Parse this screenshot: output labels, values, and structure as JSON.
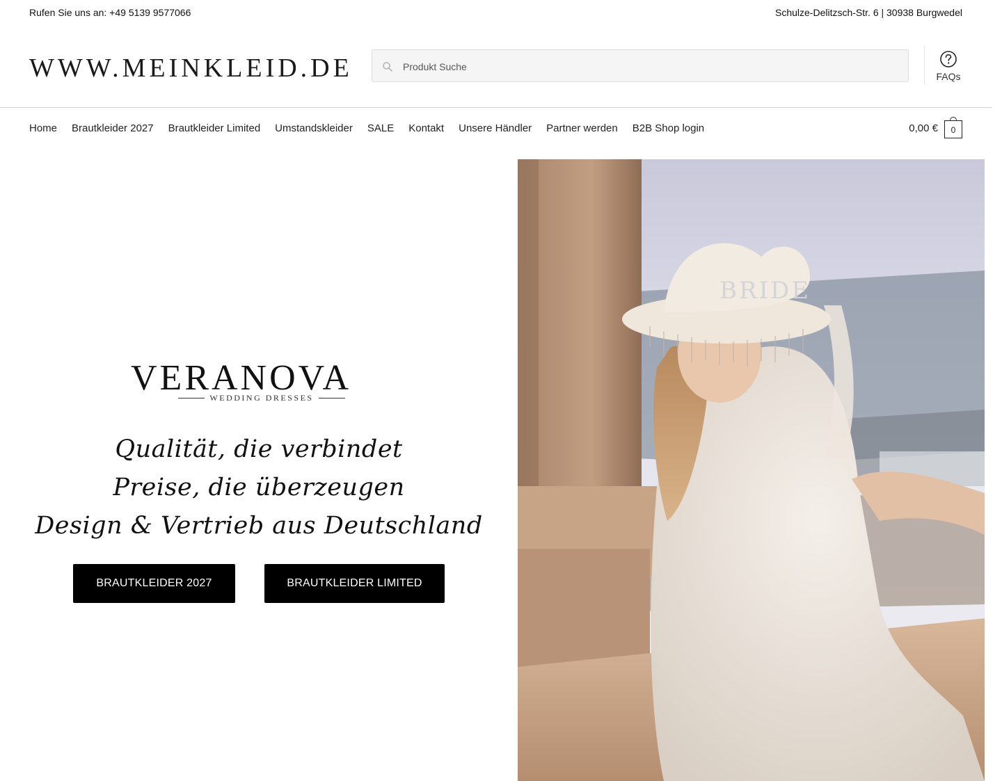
{
  "topbar": {
    "phone_text": "Rufen Sie uns an: +49 5139 9577066",
    "address_text": "Schulze-Delitzsch-Str. 6 | 30938 Burgwedel"
  },
  "header": {
    "logo_text": "WWW.MEINKLEID.DE",
    "search_placeholder": "Produkt Suche",
    "faq_label": "FAQs"
  },
  "nav": {
    "items": [
      {
        "label": "Home"
      },
      {
        "label": "Brautkleider 2027"
      },
      {
        "label": "Brautkleider Limited"
      },
      {
        "label": "Umstandskleider"
      },
      {
        "label": "SALE"
      },
      {
        "label": "Kontakt"
      },
      {
        "label": "Unsere Händler"
      },
      {
        "label": "Partner werden"
      },
      {
        "label": "B2B Shop login"
      }
    ],
    "cart_total": "0,00 €",
    "cart_count": "0"
  },
  "hero": {
    "brand_name": "VERANOVA",
    "brand_subtitle": "WEDDING DRESSES",
    "taglines": [
      "Qualität, die verbindet",
      "Preise, die überzeugen",
      "Design & Vertrieb aus Deutschland"
    ],
    "buttons": [
      {
        "label": "BRAUTKLEIDER 2027"
      },
      {
        "label": "BRAUTKLEIDER LIMITED"
      }
    ],
    "photo": {
      "hat_text": "BRIDE"
    }
  },
  "colors": {
    "button_bg": "#000000",
    "button_text": "#ffffff",
    "search_bg": "#f5f5f5"
  }
}
